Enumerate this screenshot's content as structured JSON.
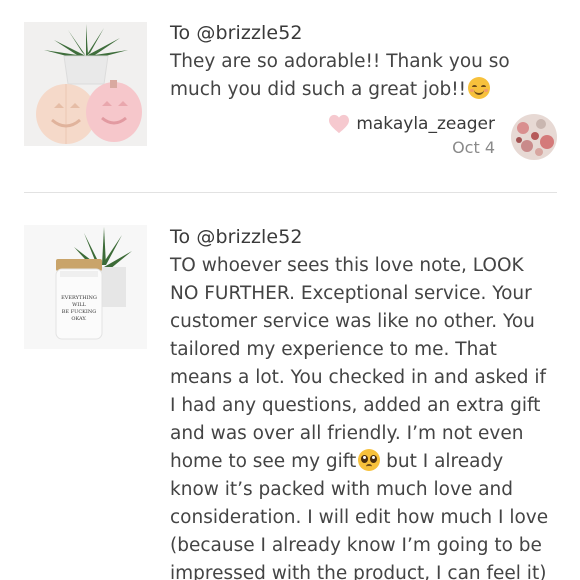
{
  "notes": [
    {
      "to": "To @brizzle52",
      "lines": [
        "They are so adorable!! Thank you so",
        "much you did such a great job!!"
      ],
      "author": "makayla_zeager",
      "date": "Oct 4"
    },
    {
      "to": "To @brizzle52",
      "candle_label": [
        "EVERYTHING WILL",
        "BE FUCKING OKAY."
      ],
      "lines": [
        "TO whoever sees this love note, LOOK",
        "NO FURTHER. Exceptional service. Your",
        "customer service was like no other. You",
        "tailored my experience to me. That",
        "means a lot. You checked in and asked if",
        "I had any questions, added an extra gift",
        "and was over all friendly. I’m not even",
        "home to see my gift",
        " but I already",
        "know it’s packed with much love and",
        "consideration. I will edit how much I love",
        "(because I already know I’m going to be",
        "impressed with the product, I can feel it)"
      ]
    }
  ],
  "icons": {
    "heart": "heart-icon",
    "emoji_1": "smiling-face-icon",
    "emoji_2": "pleading-face-icon"
  },
  "colors": {
    "heart": "#f6c9cf",
    "text": "#3a3a3a",
    "date": "#8a8a8a",
    "divider": "#e2e2e2"
  }
}
